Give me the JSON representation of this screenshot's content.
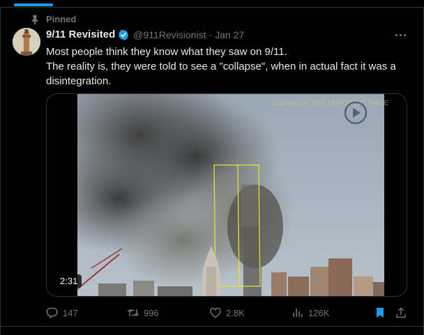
{
  "pinned_label": "Pinned",
  "author": {
    "display_name": "9/11 Revisited",
    "handle": "@911Revisionist",
    "date": "Jan 27"
  },
  "tweet": {
    "line1": "Most people think they know what they saw on 9/11.",
    "line2": "The reality is, they were told to see a \"collapse\", when in actual fact it was a disintegration."
  },
  "media": {
    "duration": "2:31",
    "watermark": "Captured in 2001 UNFORGETTABLE"
  },
  "actions": {
    "replies": "147",
    "reposts": "996",
    "likes": "2.8K",
    "views": "126K"
  },
  "icons": {
    "pinned": "pin-icon",
    "verified": "verified-badge-icon",
    "more": "more-icon",
    "play": "play-icon",
    "reply": "reply-icon",
    "repost": "repost-icon",
    "like": "heart-icon",
    "views": "views-chart-icon",
    "bookmark": "bookmark-icon",
    "share": "share-icon"
  },
  "colors": {
    "accent": "#1d9bf0",
    "muted": "#71767b",
    "text": "#e7e9ea",
    "background": "#000000"
  }
}
